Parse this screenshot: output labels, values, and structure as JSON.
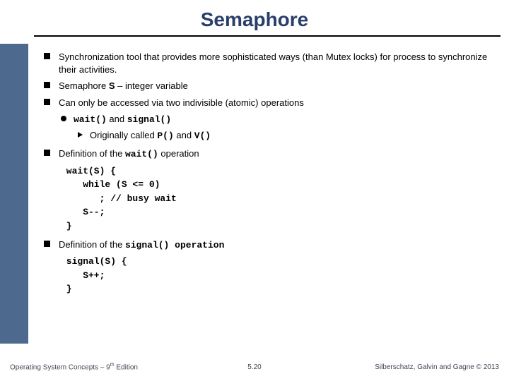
{
  "title": "Semaphore",
  "b1": "Synchronization tool that provides more sophisticated ways (than Mutex locks)  for process to synchronize their activities.",
  "b2_pre": "Semaphore ",
  "b2_bold": "S",
  "b2_post": " – integer variable",
  "b3": "Can only be accessed via two indivisible (atomic) operations",
  "b3_1_a": "wait()",
  "b3_1_mid": " and ",
  "b3_1_b": "signal()",
  "b3_1_1_pre": "Originally called ",
  "b3_1_1_a": "P()",
  "b3_1_1_mid": " and ",
  "b3_1_1_b": "V()",
  "b4_pre": "Definition of  the ",
  "b4_code": "wait()",
  "b4_post": " operation",
  "c1": " wait(S) { ",
  "c2": "    while (S <= 0) ",
  "c3": "       ; // busy wait",
  "c4": "    S--;",
  "c5": " }",
  "b5_pre": "Definition of  the ",
  "b5_code": "signal() operation",
  "c6": " signal(S) { ",
  "c7": "    S++;",
  "c8": " }",
  "footer_left_a": "Operating System Concepts – 9",
  "footer_left_b": " Edition",
  "footer_center": "5.20",
  "footer_right": "Silberschatz, Galvin and Gagne © 2013"
}
